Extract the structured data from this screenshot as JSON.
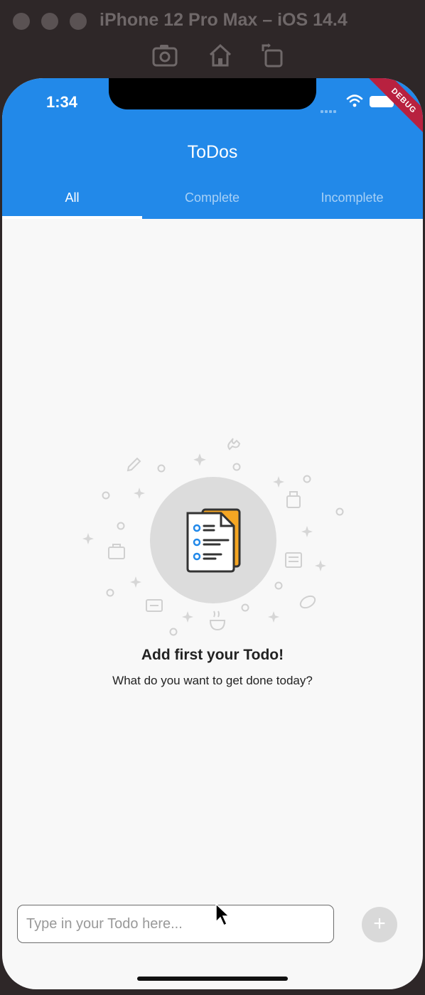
{
  "simulator": {
    "title": "iPhone 12 Pro Max – iOS 14.4",
    "tools": [
      "screenshot-icon",
      "home-icon",
      "rotate-icon"
    ]
  },
  "status_bar": {
    "time": "1:34",
    "debug_banner": "DEBUG"
  },
  "app": {
    "title": "ToDos",
    "tabs": [
      {
        "label": "All",
        "active": true
      },
      {
        "label": "Complete",
        "active": false
      },
      {
        "label": "Incomplete",
        "active": false
      }
    ],
    "accent_color": "#2289e9"
  },
  "empty_state": {
    "title": "Add first your Todo!",
    "subtitle": "What do you want to get done today?",
    "icon": "todo-document-icon"
  },
  "input": {
    "placeholder": "Type in your Todo here...",
    "value": ""
  },
  "add_button": {
    "label": "+"
  }
}
